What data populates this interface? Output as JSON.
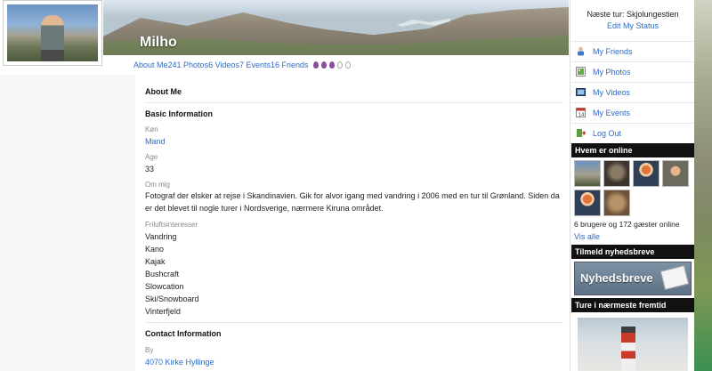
{
  "profile": {
    "name": "Milho"
  },
  "tabs": [
    {
      "label": "About Me"
    },
    {
      "label": "241 Photos"
    },
    {
      "label": "6 Videos"
    },
    {
      "label": "7 Events"
    },
    {
      "label": "16 Friends"
    }
  ],
  "rating": {
    "filled": 3,
    "total": 5,
    "filled_color": "#8d4ea0"
  },
  "about": {
    "heading": "About Me",
    "basic_heading": "Basic Information",
    "fields": {
      "gender_label": "Køn",
      "gender_value": "Mand",
      "age_label": "Age",
      "age_value": "33",
      "about_label": "Om mig",
      "about_value": "Fotograf der elsker at rejse i Skandinavien. Gik for alvor igang med vandring i 2006 med en tur til Grønland. Siden da er det blevet til nogle turer i Nordsverige, nærmere Kiruna området.",
      "interests_label": "Friluftsinteresser",
      "interests": [
        "Vandring",
        "Kano",
        "Kajak",
        "Bushcraft",
        "Slowcation",
        "Ski/Snowboard",
        "Vinterfjeld"
      ]
    },
    "contact_heading": "Contact Information",
    "city_label": "By",
    "city_value": "4070 Kirke Hyllinge"
  },
  "sidebar": {
    "next_trip": "Næste tur: Skjolungestien",
    "edit_status": "Edit My Status",
    "nav": [
      {
        "label": "My Friends",
        "icon": "friends-icon"
      },
      {
        "label": "My Photos",
        "icon": "photos-icon"
      },
      {
        "label": "My Videos",
        "icon": "videos-icon"
      },
      {
        "label": "My Events",
        "icon": "events-icon"
      },
      {
        "label": "Log Out",
        "icon": "logout-icon"
      }
    ],
    "online_title": "Hvem er online",
    "online_count": "6 brugere og 172 gæster online",
    "see_all": "Vis alle",
    "newsletter_title": "Tilmeld nyhedsbreve",
    "newsletter_banner": "Nyhedsbreve",
    "upcoming_title": "Ture i nærmeste fremtid"
  },
  "colors": {
    "link": "#2d6bc7",
    "bar_bg": "#111111"
  }
}
